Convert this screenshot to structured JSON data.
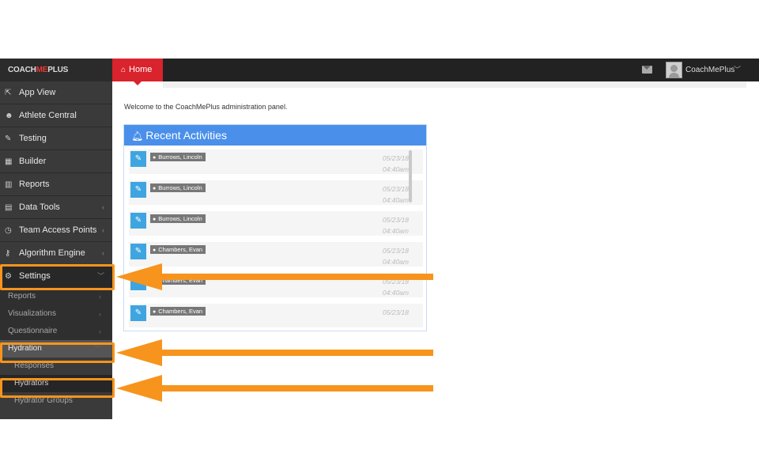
{
  "topbar": {
    "brand_prefix": "COACH",
    "brand_accent": "ME",
    "brand_suffix": "PLUS",
    "home_tab": "Home",
    "user_name": "CoachMePlus"
  },
  "sidebar": {
    "items": [
      {
        "label": "App View",
        "icon": "external-link-icon"
      },
      {
        "label": "Athlete Central",
        "icon": "users-icon"
      },
      {
        "label": "Testing",
        "icon": "edit-icon"
      },
      {
        "label": "Builder",
        "icon": "calendar-icon"
      },
      {
        "label": "Reports",
        "icon": "bar-chart-icon"
      },
      {
        "label": "Data Tools",
        "icon": "table-icon"
      },
      {
        "label": "Team Access Points",
        "icon": "dashboard-icon"
      },
      {
        "label": "Algorithm Engine",
        "icon": "key-icon"
      },
      {
        "label": "Settings",
        "icon": "gears-icon"
      }
    ],
    "settings_sub": [
      "Reports",
      "Visualizations",
      "Questionnaire",
      "Hydration"
    ],
    "hydration_sub": [
      "Responses",
      "Hydrators",
      "Hydrator Groups"
    ]
  },
  "main": {
    "welcome": "Welcome to the CoachMePlus administration panel.",
    "panel_title": "Recent Activities",
    "activities": [
      {
        "name": "Burrows, Lincoln",
        "date": "05/23/18",
        "time": "04:40am"
      },
      {
        "name": "Burrows, Lincoln",
        "date": "05/23/18",
        "time": "04:40am"
      },
      {
        "name": "Burrows, Lincoln",
        "date": "05/23/18",
        "time": "04:40am"
      },
      {
        "name": "Chambers, Evan",
        "date": "05/23/18",
        "time": "04:40am"
      },
      {
        "name": "Chambers, Evan",
        "date": "05/23/18",
        "time": "04:40am"
      },
      {
        "name": "Chambers, Evan",
        "date": "05/23/18",
        "time": ""
      }
    ]
  },
  "colors": {
    "home_tab": "#d9232d",
    "panel_header": "#4a8fea",
    "edit_button": "#3fa5e0",
    "annotation": "#f7941d"
  }
}
